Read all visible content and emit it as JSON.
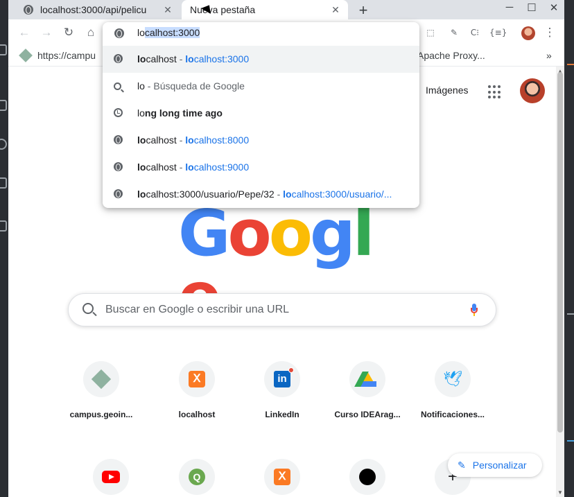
{
  "tabs": [
    {
      "title": "localhost:3000/api/pelicu",
      "active": false
    },
    {
      "title": "Nueva pestaña",
      "active": true
    }
  ],
  "toolbar": {
    "back": "←",
    "forward": "→",
    "reload": "↻",
    "home": "⌂",
    "extensions": [
      "⬚",
      "✎",
      "C⁝",
      "{≡}"
    ],
    "menu": "⋮"
  },
  "bookmarks": [
    {
      "label": "https://campu",
      "icon": "geoinfo-icon"
    },
    {
      "label": "Apache Proxy...",
      "icon": "folder-icon"
    }
  ],
  "bookmarks_overflow": "»",
  "omnibox": {
    "typed": "lo",
    "completion": "calhost:3000",
    "suggestions": [
      {
        "icon": "globe-icon",
        "match": "lo",
        "rest": "calhost",
        "sep": " - ",
        "url_match": "lo",
        "url_rest": "calhost:3000",
        "highlighted": true
      },
      {
        "icon": "search-icon",
        "match": "lo",
        "rest": "",
        "sep": " - ",
        "desc": "Búsqueda de Google",
        "highlighted": false
      },
      {
        "icon": "clock-icon",
        "match": "lo",
        "rest": "ng long time ago",
        "highlighted": false
      },
      {
        "icon": "globe-icon",
        "match": "lo",
        "rest": "calhost",
        "sep": " - ",
        "url_match": "lo",
        "url_rest": "calhost:8000",
        "highlighted": false
      },
      {
        "icon": "globe-icon",
        "match": "lo",
        "rest": "calhost",
        "sep": " - ",
        "url_match": "lo",
        "url_rest": "calhost:9000",
        "highlighted": false
      },
      {
        "icon": "globe-icon",
        "match": "lo",
        "rest": "calhost:3000/usuario/Pepe/32",
        "sep": " - ",
        "url_match": "lo",
        "url_rest": "calhost:3000/usuario/...",
        "highlighted": false
      }
    ]
  },
  "ntp": {
    "images_link": "Imágenes",
    "logo": [
      {
        "ch": "G",
        "color": "#4285f4"
      },
      {
        "ch": "o",
        "color": "#ea4335"
      },
      {
        "ch": "o",
        "color": "#fbbc05"
      },
      {
        "ch": "g",
        "color": "#4285f4"
      },
      {
        "ch": "l",
        "color": "#34a853"
      },
      {
        "ch": "e",
        "color": "#ea4335"
      }
    ],
    "search_placeholder": "Buscar en Google o escribir una URL",
    "shortcuts_row1": [
      {
        "name": "campus.geoin...",
        "icon": "geoinfo-icon"
      },
      {
        "name": "localhost",
        "icon": "xampp-icon"
      },
      {
        "name": "LinkedIn",
        "icon": "linkedin-icon"
      },
      {
        "name": "Curso IDEArag...",
        "icon": "drive-icon"
      },
      {
        "name": "Notificaciones...",
        "icon": "twitter-icon"
      }
    ],
    "shortcuts_row2": [
      {
        "icon": "youtube-icon"
      },
      {
        "icon": "qgis-icon"
      },
      {
        "icon": "xampp-icon"
      },
      {
        "icon": "github-icon"
      },
      {
        "icon": "add-shortcut-icon",
        "glyph": "+"
      }
    ],
    "customize_label": "Personalizar"
  },
  "colors": {
    "accent": "#1a73e8",
    "selection": "#c8ddff",
    "tabstrip": "#dee1e6"
  }
}
